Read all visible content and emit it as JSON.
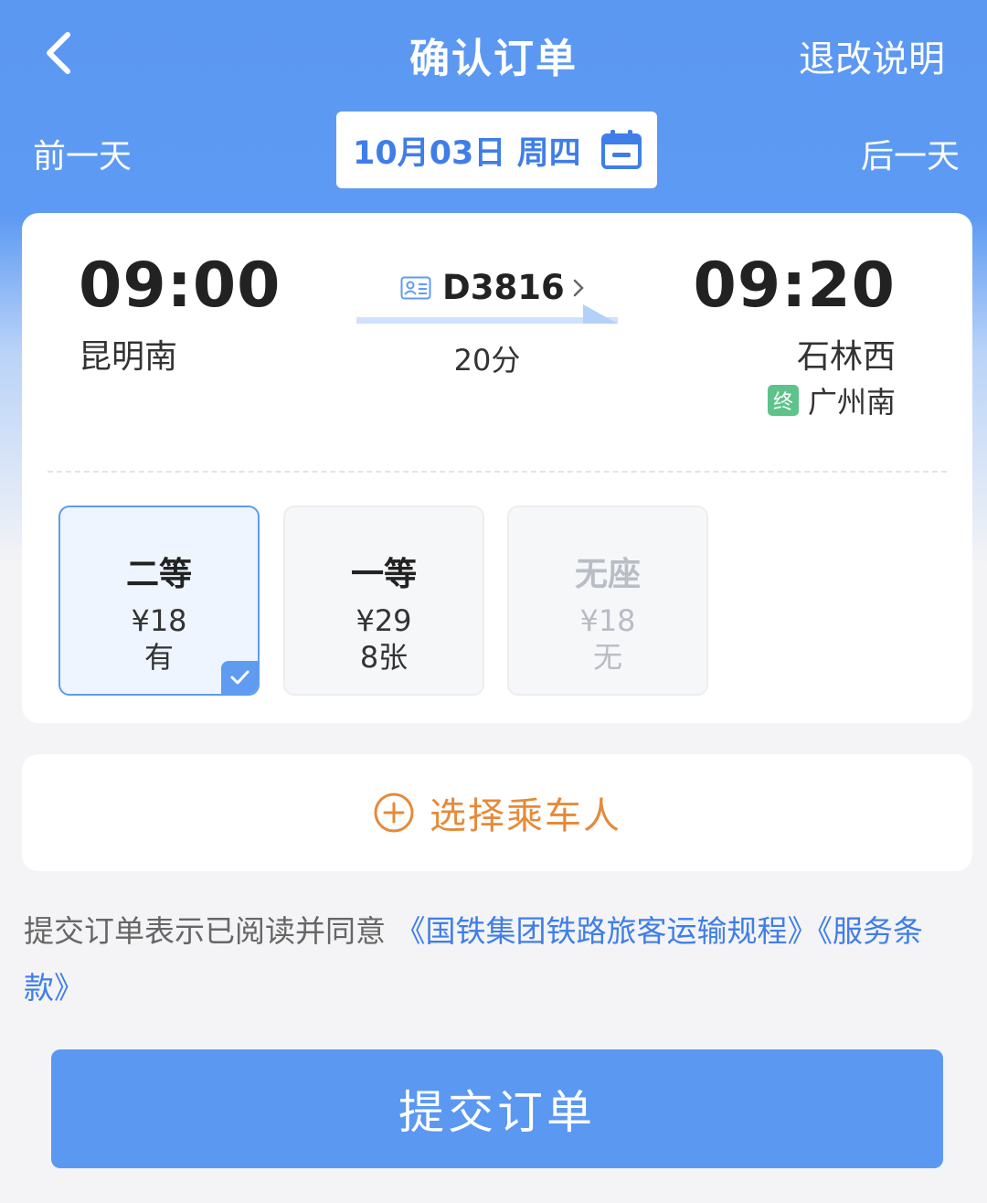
{
  "header": {
    "title": "确认订单",
    "refund_link": "退改说明",
    "prev_day": "前一天",
    "next_day": "后一天",
    "date": "10月03日  周四"
  },
  "train": {
    "dep_time": "09:00",
    "dep_station": "昆明南",
    "arr_time": "09:20",
    "arr_station": "石林西",
    "train_no": "D3816",
    "duration": "20分",
    "terminal_badge": "终",
    "terminal_station": "广州南"
  },
  "seats": [
    {
      "name": "二等",
      "price": "¥18",
      "availability": "有",
      "selected": true
    },
    {
      "name": "一等",
      "price": "¥29",
      "availability": "8张",
      "selected": false
    },
    {
      "name": "无座",
      "price": "¥18",
      "availability": "无",
      "selected": false
    }
  ],
  "passenger": {
    "label": "选择乘车人"
  },
  "agreement": {
    "prefix": "提交订单表示已阅读并同意 ",
    "link1": "《国铁集团铁路旅客运输规程》",
    "link2": "《服务条款》"
  },
  "submit": {
    "label": "提交订单"
  },
  "colors": {
    "primary": "#5b98f2",
    "accent_orange": "#e58a3a",
    "link_blue": "#3f7ee8",
    "terminal_green": "#5ec28b"
  },
  "icons": [
    "back-arrow-icon",
    "calendar-icon",
    "id-card-icon",
    "chevron-right-icon",
    "route-arrow-icon",
    "plus-circle-icon",
    "check-icon"
  ]
}
